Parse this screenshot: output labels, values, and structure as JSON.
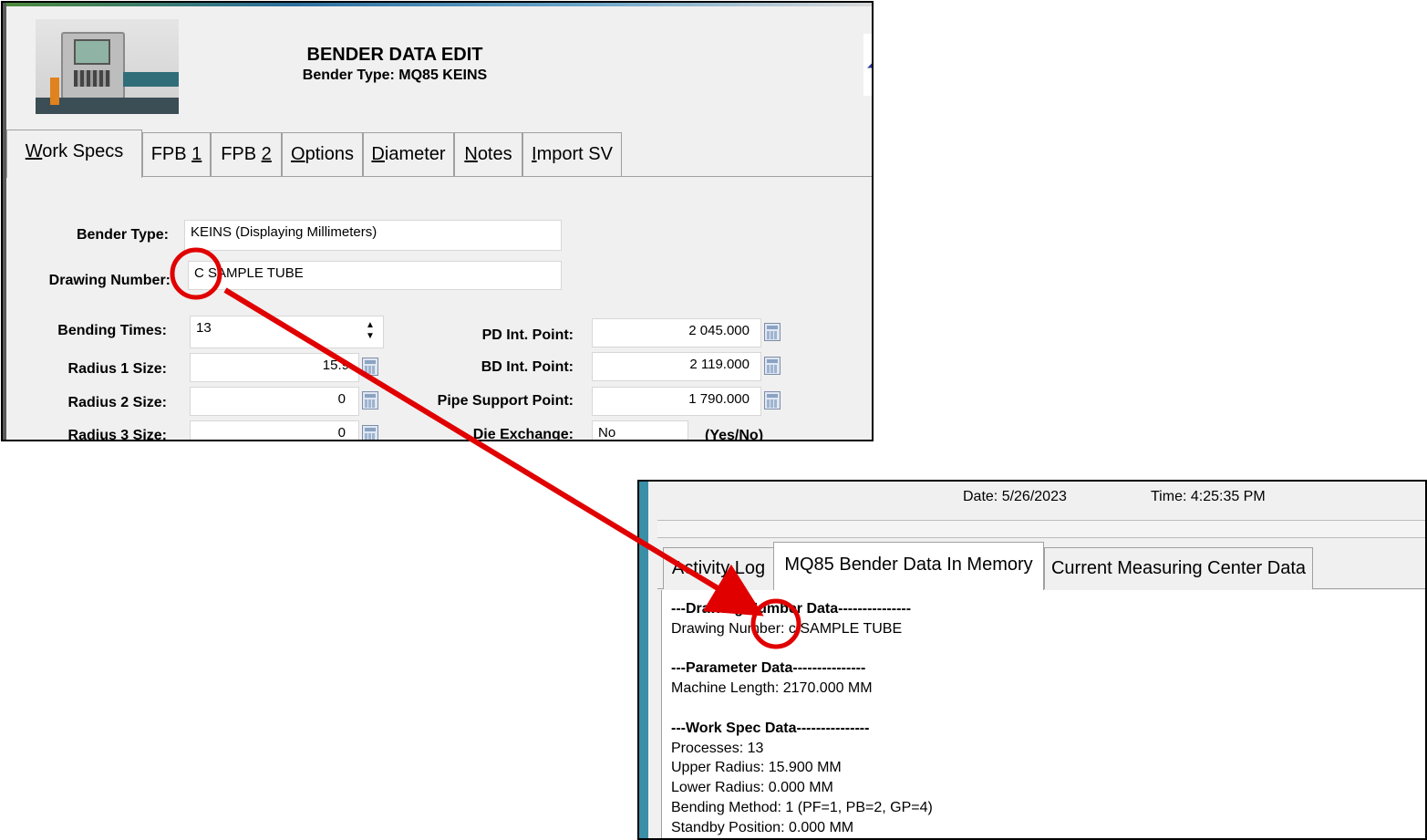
{
  "bender_form": {
    "title": "BENDER DATA EDIT",
    "subtitle": "Bender Type: MQ85 KEINS",
    "tabs": [
      {
        "pre": "",
        "u": "W",
        "post": "ork Specs"
      },
      {
        "pre": "FPB ",
        "u": "1",
        "post": ""
      },
      {
        "pre": "FPB ",
        "u": "2",
        "post": ""
      },
      {
        "pre": "",
        "u": "O",
        "post": "ptions"
      },
      {
        "pre": "",
        "u": "D",
        "post": "iameter"
      },
      {
        "pre": "",
        "u": "N",
        "post": "otes"
      },
      {
        "pre": "",
        "u": "I",
        "post": "mport SV"
      }
    ],
    "fields": {
      "bender_type_label": "Bender Type:",
      "bender_type_value": "KEINS (Displaying Millimeters)",
      "drawing_number_label": "Drawing Number:",
      "drawing_number_value": "C SAMPLE TUBE",
      "bending_times_label": "Bending Times:",
      "bending_times_value": "13",
      "radius1_label": "Radius 1 Size:",
      "radius1_value": "15.9",
      "radius2_label": "Radius 2 Size:",
      "radius2_value": "0",
      "radius3_label": "Radius 3 Size:",
      "radius3_value": "0",
      "pd_label": "PD Int. Point:",
      "pd_value": "2 045.000",
      "bd_label": "BD Int. Point:",
      "bd_value": "2 119.000",
      "pipe_label": "Pipe Support Point:",
      "pipe_value": "1 790.000",
      "die_label": "Die Exchange:",
      "die_value": "No",
      "die_hint": "(Yes/No)"
    }
  },
  "memory_view": {
    "date": "Date: 5/26/2023",
    "time": "Time: 4:25:35 PM",
    "tabs": [
      "Activity Log",
      "MQ85 Bender Data In Memory",
      "Current Measuring Center Data"
    ],
    "lines": [
      {
        "text": "---Drawing Number Data---------------",
        "bold": true
      },
      {
        "text": "Drawing Number: c SAMPLE TUBE",
        "bold": false
      },
      {
        "text": "",
        "bold": false
      },
      {
        "text": "---Parameter Data---------------",
        "bold": true
      },
      {
        "text": "Machine Length: 2170.000 MM",
        "bold": false
      },
      {
        "text": "",
        "bold": false
      },
      {
        "text": "---Work Spec Data---------------",
        "bold": true
      },
      {
        "text": "Processes: 13",
        "bold": false
      },
      {
        "text": "Upper Radius: 15.900 MM",
        "bold": false
      },
      {
        "text": "Lower Radius: 0.000 MM",
        "bold": false
      },
      {
        "text": "Bending Method: 1 (PF=1, PB=2, GP=4)",
        "bold": false
      },
      {
        "text": "Standby Position: 0.000 MM",
        "bold": false
      }
    ]
  },
  "annotation": {
    "color": "#e00000"
  }
}
